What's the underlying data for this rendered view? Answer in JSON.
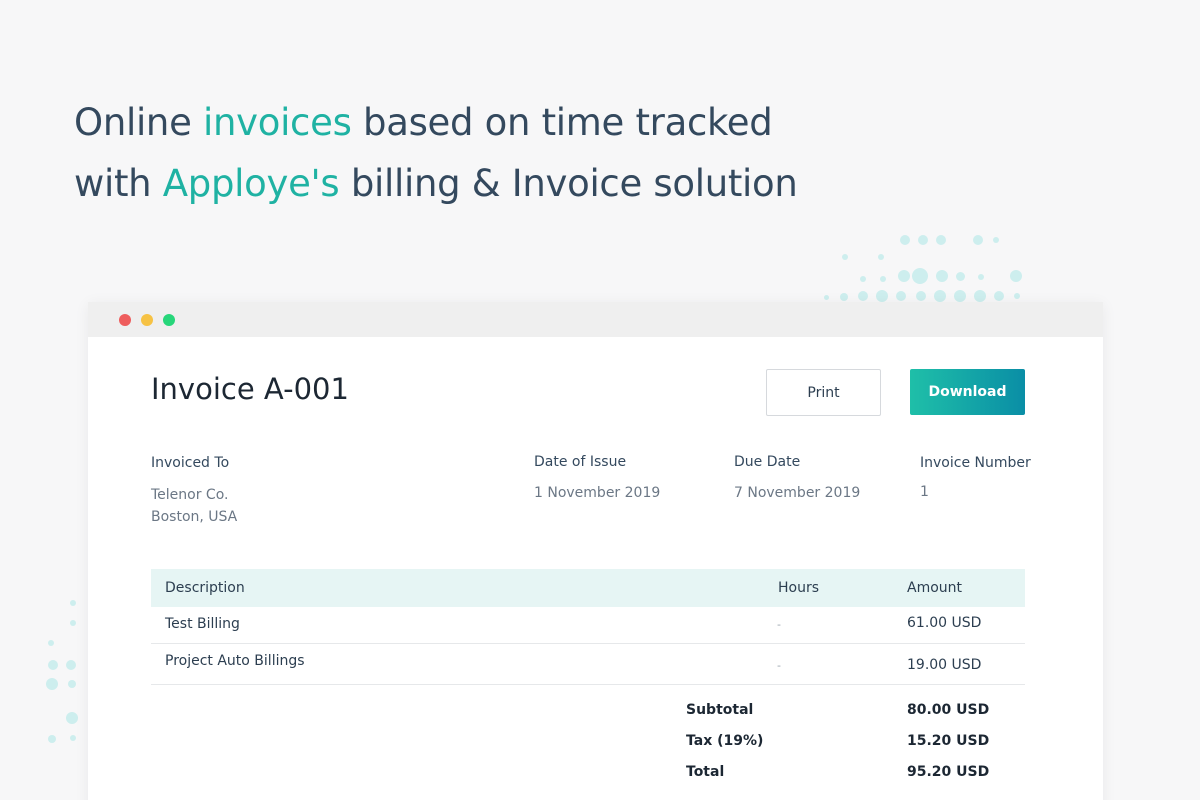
{
  "headline": {
    "line1_pre": "Online ",
    "line1_accent": "invoices",
    "line1_post": " based on time tracked",
    "line2_pre": "with ",
    "line2_accent": "Apploye's",
    "line2_post": " billing & Invoice solution"
  },
  "colors": {
    "accent": "#1fb2a3",
    "download_gradient_start": "#1fbfa8",
    "download_gradient_end": "#0a8ea6",
    "table_header_bg": "#e6f5f4"
  },
  "invoice": {
    "title": "Invoice A-001",
    "print_label": "Print",
    "download_label": "Download",
    "invoiced_to_label": "Invoiced To",
    "client_name": "Telenor Co.",
    "client_location": "Boston, USA",
    "date_of_issue_label": "Date of Issue",
    "date_of_issue": "1 November 2019",
    "due_date_label": "Due Date",
    "due_date": "7 November 2019",
    "invoice_number_label": "Invoice Number",
    "invoice_number": "1"
  },
  "table": {
    "headers": {
      "description": "Description",
      "hours": "Hours",
      "amount": "Amount"
    },
    "rows": [
      {
        "description": "Test Billing",
        "hours": "-",
        "amount": "61.00 USD"
      },
      {
        "description": "Project Auto Billings",
        "hours": "-",
        "amount": "19.00 USD"
      }
    ]
  },
  "totals": {
    "subtotal_label": "Subtotal",
    "subtotal": "80.00 USD",
    "tax_label": "Tax (19%)",
    "tax": "15.20 USD",
    "total_label": "Total",
    "total": "95.20 USD"
  }
}
